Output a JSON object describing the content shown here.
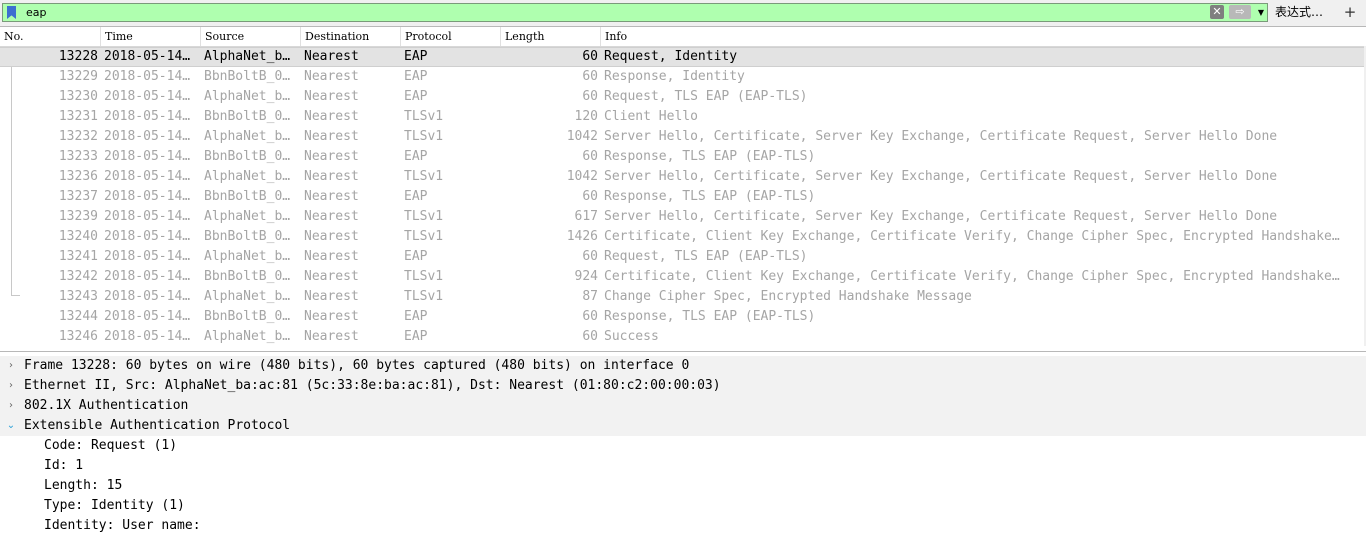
{
  "filter": {
    "value": "eap",
    "clear_label": "✕",
    "apply_label": "⇨",
    "dropdown_label": "▼",
    "expression_label": "表达式…",
    "add_label": "+"
  },
  "packet_list": {
    "columns": [
      "No.",
      "Time",
      "Source",
      "Destination",
      "Protocol",
      "Length",
      "Info"
    ],
    "rows": [
      {
        "no": "13228",
        "time": "2018-05-14…",
        "src": "AlphaNet_b…",
        "dst": "Nearest",
        "proto": "EAP",
        "len": "60",
        "info": "Request, Identity",
        "selected": true
      },
      {
        "no": "13229",
        "time": "2018-05-14…",
        "src": "BbnBoltB_0…",
        "dst": "Nearest",
        "proto": "EAP",
        "len": "60",
        "info": "Response, Identity"
      },
      {
        "no": "13230",
        "time": "2018-05-14…",
        "src": "AlphaNet_b…",
        "dst": "Nearest",
        "proto": "EAP",
        "len": "60",
        "info": "Request, TLS EAP (EAP-TLS)"
      },
      {
        "no": "13231",
        "time": "2018-05-14…",
        "src": "BbnBoltB_0…",
        "dst": "Nearest",
        "proto": "TLSv1",
        "len": "120",
        "info": "Client Hello"
      },
      {
        "no": "13232",
        "time": "2018-05-14…",
        "src": "AlphaNet_b…",
        "dst": "Nearest",
        "proto": "TLSv1",
        "len": "1042",
        "info": "Server Hello, Certificate, Server Key Exchange, Certificate Request, Server Hello Done"
      },
      {
        "no": "13233",
        "time": "2018-05-14…",
        "src": "BbnBoltB_0…",
        "dst": "Nearest",
        "proto": "EAP",
        "len": "60",
        "info": "Response, TLS EAP (EAP-TLS)"
      },
      {
        "no": "13236",
        "time": "2018-05-14…",
        "src": "AlphaNet_b…",
        "dst": "Nearest",
        "proto": "TLSv1",
        "len": "1042",
        "info": "Server Hello, Certificate, Server Key Exchange, Certificate Request, Server Hello Done"
      },
      {
        "no": "13237",
        "time": "2018-05-14…",
        "src": "BbnBoltB_0…",
        "dst": "Nearest",
        "proto": "EAP",
        "len": "60",
        "info": "Response, TLS EAP (EAP-TLS)"
      },
      {
        "no": "13239",
        "time": "2018-05-14…",
        "src": "AlphaNet_b…",
        "dst": "Nearest",
        "proto": "TLSv1",
        "len": "617",
        "info": "Server Hello, Certificate, Server Key Exchange, Certificate Request, Server Hello Done"
      },
      {
        "no": "13240",
        "time": "2018-05-14…",
        "src": "BbnBoltB_0…",
        "dst": "Nearest",
        "proto": "TLSv1",
        "len": "1426",
        "info": "Certificate, Client Key Exchange, Certificate Verify, Change Cipher Spec, Encrypted Handshake…"
      },
      {
        "no": "13241",
        "time": "2018-05-14…",
        "src": "AlphaNet_b…",
        "dst": "Nearest",
        "proto": "EAP",
        "len": "60",
        "info": "Request, TLS EAP (EAP-TLS)"
      },
      {
        "no": "13242",
        "time": "2018-05-14…",
        "src": "BbnBoltB_0…",
        "dst": "Nearest",
        "proto": "TLSv1",
        "len": "924",
        "info": "Certificate, Client Key Exchange, Certificate Verify, Change Cipher Spec, Encrypted Handshake…"
      },
      {
        "no": "13243",
        "time": "2018-05-14…",
        "src": "AlphaNet_b…",
        "dst": "Nearest",
        "proto": "TLSv1",
        "len": "87",
        "info": "Change Cipher Spec, Encrypted Handshake Message"
      },
      {
        "no": "13244",
        "time": "2018-05-14…",
        "src": "BbnBoltB_0…",
        "dst": "Nearest",
        "proto": "EAP",
        "len": "60",
        "info": "Response, TLS EAP (EAP-TLS)"
      },
      {
        "no": "13246",
        "time": "2018-05-14…",
        "src": "AlphaNet_b…",
        "dst": "Nearest",
        "proto": "EAP",
        "len": "60",
        "info": "Success"
      }
    ]
  },
  "detail": {
    "items": [
      {
        "text": "Frame 13228: 60 bytes on wire (480 bits), 60 bytes captured (480 bits) on interface 0",
        "level": 0,
        "expanded": false
      },
      {
        "text": "Ethernet II, Src: AlphaNet_ba:ac:81 (5c:33:8e:ba:ac:81), Dst: Nearest (01:80:c2:00:00:03)",
        "level": 0,
        "expanded": false
      },
      {
        "text": "802.1X Authentication",
        "level": 0,
        "expanded": false
      },
      {
        "text": "Extensible Authentication Protocol",
        "level": 0,
        "expanded": true
      },
      {
        "text": "Code: Request (1)",
        "level": 1
      },
      {
        "text": "Id: 1",
        "level": 1
      },
      {
        "text": "Length: 15",
        "level": 1
      },
      {
        "text": "Type: Identity (1)",
        "level": 1
      },
      {
        "text": "Identity: User name:",
        "level": 1
      }
    ]
  },
  "icons": {
    "bookmark": "bookmark-icon",
    "collapsed": "›",
    "expanded": "⌄"
  },
  "colors": {
    "filter_valid_bg": "#afffaf",
    "selected_row_bg": "#e3e3e3",
    "dim_text": "#a5a5a5",
    "expand_arrow": "#2aa0d8"
  }
}
